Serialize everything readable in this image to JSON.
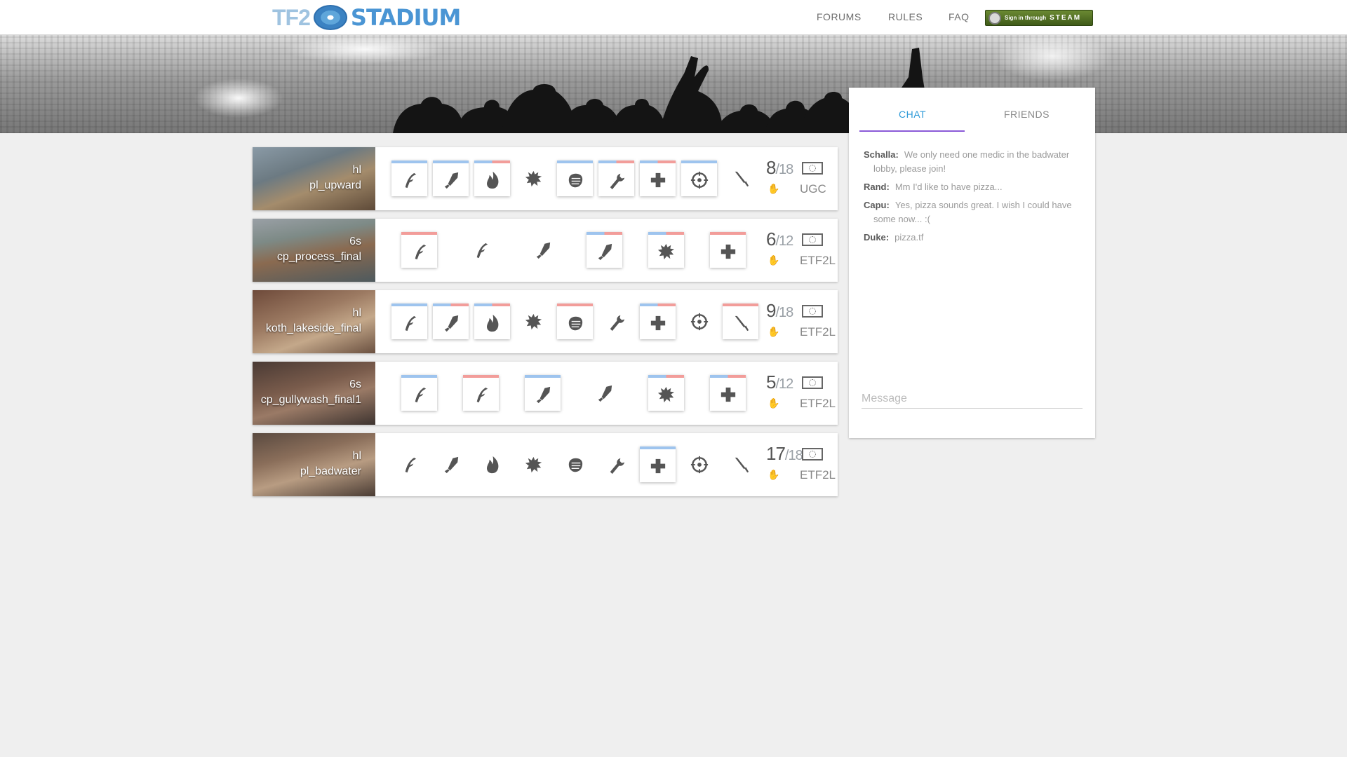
{
  "header": {
    "logo_text_left": "TF2",
    "logo_text_right": "STADIUM",
    "nav": [
      "FORUMS",
      "RULES",
      "FAQ"
    ],
    "steam_button": {
      "small": "Sign in through",
      "big": "STEAM"
    }
  },
  "class_icons": [
    "scout-icon",
    "soldier-icon",
    "pyro-icon",
    "demoman-icon",
    "heavy-icon",
    "engineer-icon",
    "medic-icon",
    "sniper-icon",
    "spy-icon"
  ],
  "lobbies": [
    {
      "format": "hl",
      "map": "pl_upward",
      "players": "8",
      "max": "/18",
      "league": "UGC",
      "slots": [
        {
          "icon": "scout",
          "team": "blue"
        },
        {
          "icon": "soldier",
          "team": "blue"
        },
        {
          "icon": "pyro",
          "team": "both"
        },
        {
          "icon": "demoman",
          "team": "none"
        },
        {
          "icon": "heavy",
          "team": "blue"
        },
        {
          "icon": "engineer",
          "team": "both"
        },
        {
          "icon": "medic",
          "team": "both"
        },
        {
          "icon": "sniper",
          "team": "blue"
        },
        {
          "icon": "spy",
          "team": "none"
        }
      ]
    },
    {
      "format": "6s",
      "map": "cp_process_final",
      "players": "6",
      "max": "/12",
      "league": "ETF2L",
      "slots": [
        {
          "icon": "scout",
          "team": "red"
        },
        {
          "icon": "scout",
          "team": "none"
        },
        {
          "icon": "soldier",
          "team": "none"
        },
        {
          "icon": "soldier",
          "team": "both"
        },
        {
          "icon": "demoman",
          "team": "both"
        },
        {
          "icon": "medic",
          "team": "red"
        }
      ]
    },
    {
      "format": "hl",
      "map": "koth_lakeside_final",
      "players": "9",
      "max": "/18",
      "league": "ETF2L",
      "slots": [
        {
          "icon": "scout",
          "team": "blue"
        },
        {
          "icon": "soldier",
          "team": "both"
        },
        {
          "icon": "pyro",
          "team": "both"
        },
        {
          "icon": "demoman",
          "team": "none"
        },
        {
          "icon": "heavy",
          "team": "red"
        },
        {
          "icon": "engineer",
          "team": "none"
        },
        {
          "icon": "medic",
          "team": "both"
        },
        {
          "icon": "sniper",
          "team": "none"
        },
        {
          "icon": "spy",
          "team": "red"
        }
      ]
    },
    {
      "format": "6s",
      "map": "cp_gullywash_final1",
      "players": "5",
      "max": "/12",
      "league": "ETF2L",
      "slots": [
        {
          "icon": "scout",
          "team": "blue"
        },
        {
          "icon": "scout",
          "team": "red"
        },
        {
          "icon": "soldier",
          "team": "blue"
        },
        {
          "icon": "soldier",
          "team": "none"
        },
        {
          "icon": "demoman",
          "team": "both"
        },
        {
          "icon": "medic",
          "team": "both"
        }
      ]
    },
    {
      "format": "hl",
      "map": "pl_badwater",
      "players": "17",
      "max": "/18",
      "league": "ETF2L",
      "slots": [
        {
          "icon": "scout",
          "team": "none"
        },
        {
          "icon": "soldier",
          "team": "none"
        },
        {
          "icon": "pyro",
          "team": "none"
        },
        {
          "icon": "demoman",
          "team": "none"
        },
        {
          "icon": "heavy",
          "team": "none"
        },
        {
          "icon": "engineer",
          "team": "none"
        },
        {
          "icon": "medic",
          "team": "blue"
        },
        {
          "icon": "sniper",
          "team": "none"
        },
        {
          "icon": "spy",
          "team": "none"
        }
      ]
    }
  ],
  "chat": {
    "tabs": [
      "CHAT",
      "FRIENDS"
    ],
    "messages": [
      {
        "user": "Schalla:",
        "text": "We only need one medic in the badwater lobby, please join!"
      },
      {
        "user": "Rand:",
        "text": "Mm I'd like to have pizza..."
      },
      {
        "user": "Capu:",
        "text": "Yes, pizza sounds great. I wish I could have some now... :("
      },
      {
        "user": "Duke:",
        "text": "pizza.tf"
      }
    ],
    "input_placeholder": "Message"
  },
  "colors": {
    "blu": "#9ec4ee",
    "red": "#f29d9a",
    "accent": "#2e9ad8",
    "tab_underline": "#8a5ad8",
    "steam_green": "#5a7a28"
  }
}
